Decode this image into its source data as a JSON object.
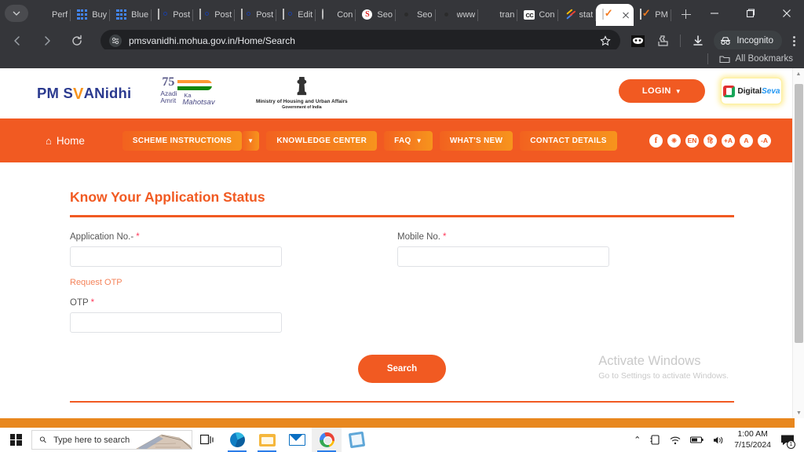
{
  "browser": {
    "tabs": [
      {
        "label": "Perf",
        "icon": "museum-icon",
        "type": "museum"
      },
      {
        "label": "Buy",
        "icon": "grid-icon",
        "type": "grid"
      },
      {
        "label": "Blue",
        "icon": "grid-icon",
        "type": "grid"
      },
      {
        "label": "Post",
        "icon": "india-flag-icon",
        "type": "flag"
      },
      {
        "label": "Post",
        "icon": "india-flag-icon",
        "type": "flag"
      },
      {
        "label": "Post",
        "icon": "india-flag-icon",
        "type": "flag"
      },
      {
        "label": "Edit",
        "icon": "india-flag-icon",
        "type": "flag"
      },
      {
        "label": "Con",
        "icon": "globe-icon",
        "type": "circ"
      },
      {
        "label": "Seo",
        "icon": "s-logo-icon",
        "type": "red"
      },
      {
        "label": "Seo",
        "icon": "firefox-icon",
        "type": "ff"
      },
      {
        "label": "www",
        "icon": "firefox-icon",
        "type": "ff"
      },
      {
        "label": "tran",
        "icon": "google-icon",
        "type": "google"
      },
      {
        "label": "Con",
        "icon": "closed-caption-icon",
        "type": "cc"
      },
      {
        "label": "stat",
        "icon": "chart-icon",
        "type": "stat"
      },
      {
        "label": "",
        "icon": "checkmark-icon",
        "type": "check",
        "active": true
      },
      {
        "label": "PM",
        "icon": "checkmark-icon",
        "type": "check"
      }
    ],
    "url": "pmsvanidhi.mohua.gov.in/Home/Search",
    "incognito_label": "Incognito",
    "bookmarks_label": "All Bookmarks"
  },
  "site": {
    "logo": {
      "pm": "PM S",
      "tick": "V",
      "nidhi": "ANidhi"
    },
    "azadi": {
      "num": "75",
      "t1": "Azadi",
      "t2": "Amrit",
      "t3": "Ka",
      "t4": "Mahotsav"
    },
    "ministry": {
      "line1": "Ministry of Housing and Urban Affairs",
      "line2": "Government of India"
    },
    "login_label": "LOGIN",
    "digital_seva": {
      "part1": "Digital",
      "part2": "Seva"
    },
    "nav": {
      "home": "Home",
      "items": [
        {
          "label": "SCHEME INSTRUCTIONS",
          "caret_box": true
        },
        {
          "label": "KNOWLEDGE CENTER",
          "caret_box": false
        },
        {
          "label": "FAQ",
          "inline_caret": true
        },
        {
          "label": "WHAT'S NEW",
          "caret_box": false
        },
        {
          "label": "CONTACT DETAILS",
          "caret_box": false
        }
      ],
      "social": [
        {
          "label": "f",
          "name": "facebook-icon"
        },
        {
          "label": "❈",
          "name": "twitter-icon"
        },
        {
          "label": "EN",
          "name": "language-english-icon"
        },
        {
          "label": "हि",
          "name": "language-hindi-icon"
        },
        {
          "label": "+A",
          "name": "increase-font-icon"
        },
        {
          "label": "A",
          "name": "normal-font-icon"
        },
        {
          "label": "-A",
          "name": "decrease-font-icon"
        }
      ]
    }
  },
  "form": {
    "title": "Know Your Application Status",
    "application_no": {
      "label": "Application No.-",
      "value": "",
      "placeholder": ""
    },
    "mobile_no": {
      "label": "Mobile No.",
      "value": "",
      "placeholder": ""
    },
    "request_otp": "Request OTP",
    "otp": {
      "label": "OTP",
      "value": "",
      "placeholder": ""
    },
    "search_label": "Search",
    "required_marker": "*"
  },
  "watermark": {
    "title": "Activate Windows",
    "subtitle": "Go to Settings to activate Windows."
  },
  "taskbar": {
    "search_placeholder": "Type here to search",
    "apps": [
      {
        "name": "task-view-icon"
      },
      {
        "name": "edge-icon"
      },
      {
        "name": "file-explorer-icon"
      },
      {
        "name": "mail-icon"
      },
      {
        "name": "chrome-icon"
      },
      {
        "name": "notepad-icon"
      }
    ],
    "time": "1:00 AM",
    "date": "7/15/2024",
    "notification_count": "1"
  },
  "colors": {
    "accent_orange": "#f15a22",
    "logo_blue": "#2b3a8f",
    "footer_orange": "#e8871e",
    "required_red": "#ff3b5c",
    "chrome_dark": "#35363a"
  }
}
